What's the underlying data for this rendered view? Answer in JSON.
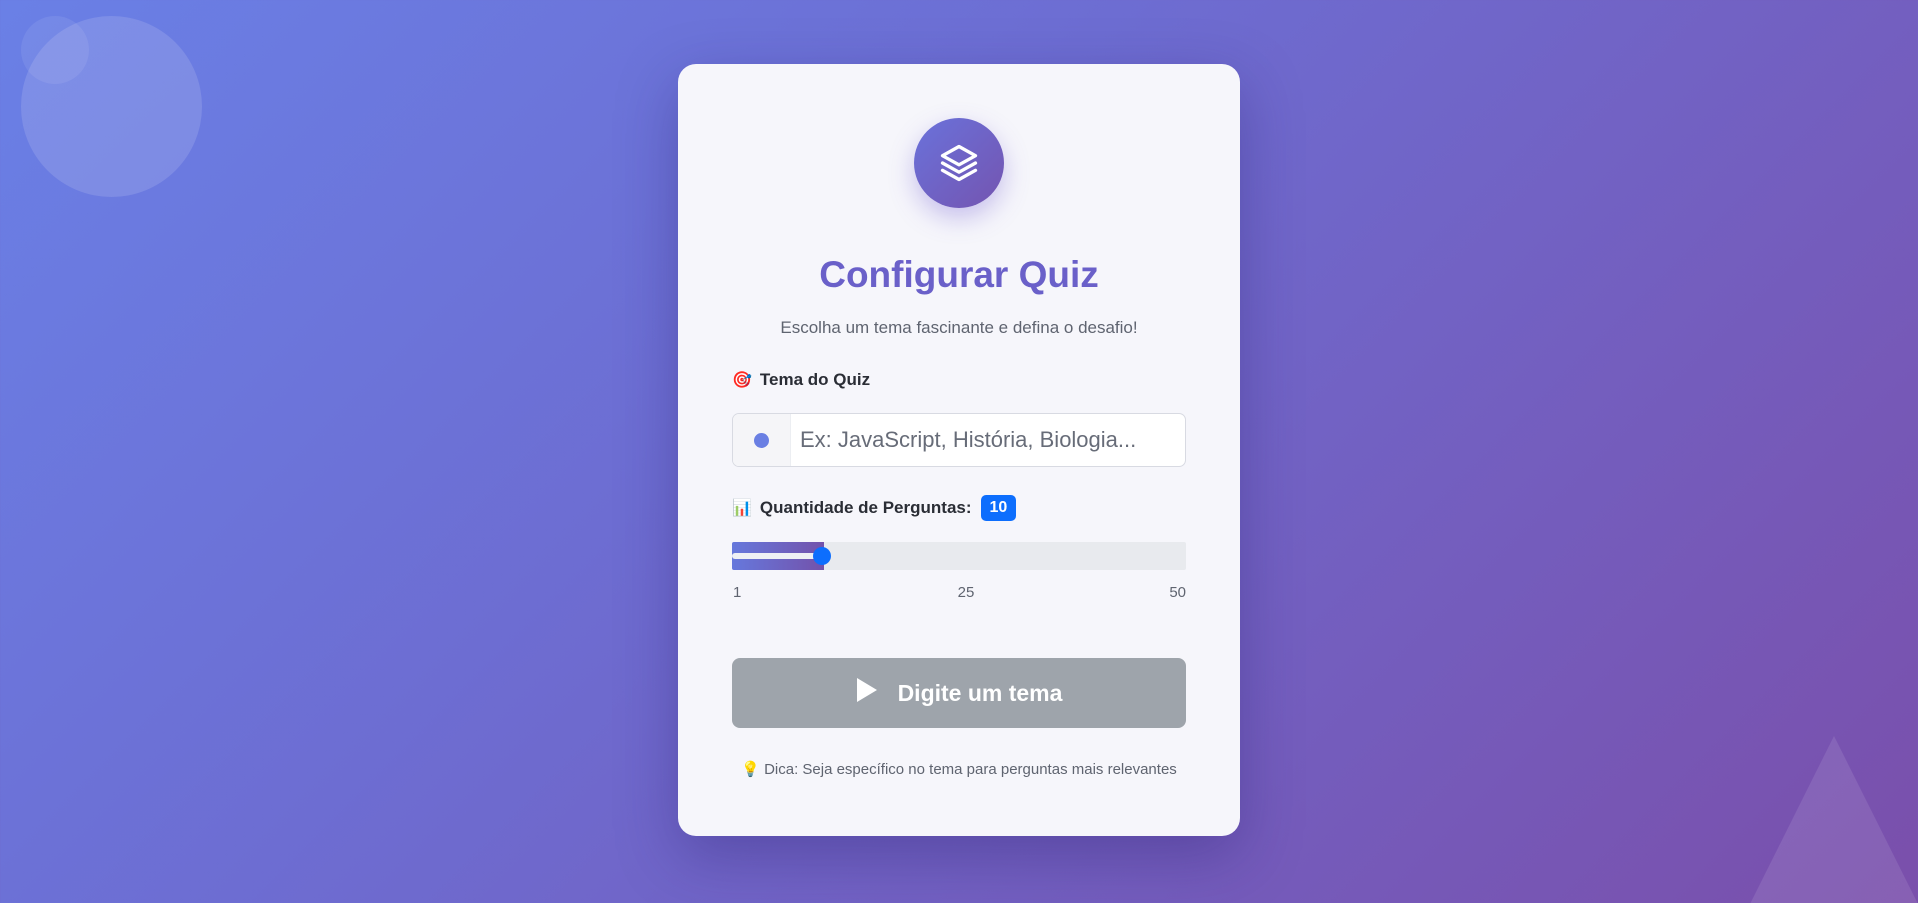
{
  "card": {
    "title": "Configurar Quiz",
    "subtitle": "Escolha um tema fascinante e defina o desafio!",
    "logo_icon": "layers-icon"
  },
  "theme_field": {
    "emoji": "🎯",
    "label": "Tema do Quiz",
    "placeholder": "Ex: JavaScript, História, Biologia...",
    "value": ""
  },
  "question_count": {
    "emoji": "📊",
    "label": "Quantidade de Perguntas:",
    "value": 10,
    "value_label": "10",
    "min": 1,
    "max": 50,
    "tick_labels": [
      "1",
      "25",
      "50"
    ]
  },
  "start_button": {
    "label": "Digite um tema",
    "icon": "play-icon",
    "disabled": true
  },
  "tip": {
    "emoji": "💡",
    "text": "Dica: Seja específico no tema para perguntas mais relevantes"
  },
  "colors": {
    "accent": "#0d6efd",
    "brand_start": "#667eea",
    "brand_end": "#764ba2",
    "disabled_button": "#9ea4ab"
  }
}
